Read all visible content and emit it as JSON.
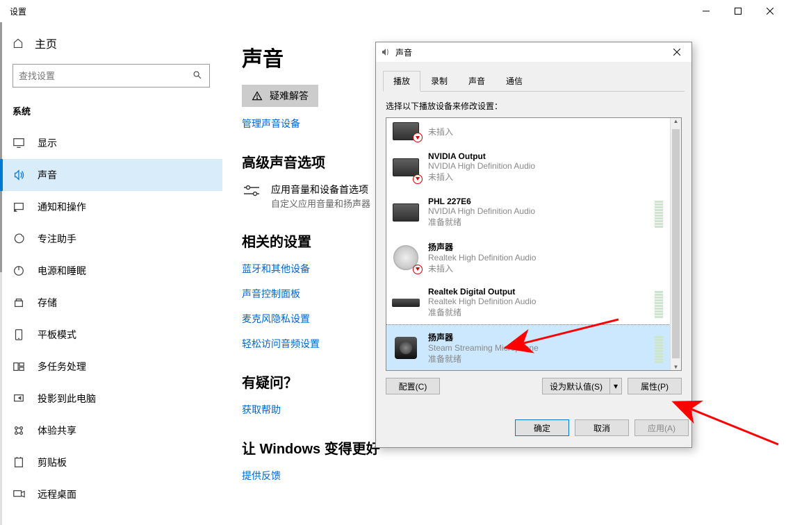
{
  "titlebar": {
    "title": "设置"
  },
  "sidebar": {
    "home": "主页",
    "search_placeholder": "查找设置",
    "section": "系统",
    "items": [
      {
        "label": "显示"
      },
      {
        "label": "声音"
      },
      {
        "label": "通知和操作"
      },
      {
        "label": "专注助手"
      },
      {
        "label": "电源和睡眠"
      },
      {
        "label": "存储"
      },
      {
        "label": "平板模式"
      },
      {
        "label": "多任务处理"
      },
      {
        "label": "投影到此电脑"
      },
      {
        "label": "体验共享"
      },
      {
        "label": "剪贴板"
      },
      {
        "label": "远程桌面"
      }
    ],
    "active_index": 1
  },
  "main": {
    "h1": "声音",
    "troubleshoot": "疑难解答",
    "manage_devices": "管理声音设备",
    "h2_advanced": "高级声音选项",
    "app_vol_title": "应用音量和设备首选项",
    "app_vol_sub": "自定义应用音量和扬声器",
    "h2_related": "相关的设置",
    "related_links": [
      "蓝牙和其他设备",
      "声音控制面板",
      "麦克风隐私设置",
      "轻松访问音频设置"
    ],
    "h2_question": "有疑问？",
    "get_help": "获取帮助",
    "h2_better": "让 Windows 变得更好",
    "feedback": "提供反馈"
  },
  "dialog": {
    "title": "声音",
    "tabs": [
      "播放",
      "录制",
      "声音",
      "通信"
    ],
    "active_tab": 0,
    "desc": "选择以下播放设备来修改设置：",
    "devices": [
      {
        "name": "",
        "sub": "",
        "status": "未插入",
        "kind": "monitor",
        "badge": true,
        "first": true
      },
      {
        "name": "NVIDIA Output",
        "sub": "NVIDIA High Definition Audio",
        "status": "未插入",
        "kind": "monitor",
        "badge": true
      },
      {
        "name": "PHL 227E6",
        "sub": "NVIDIA High Definition Audio",
        "status": "准备就绪",
        "kind": "monitor",
        "badge": false,
        "level": true
      },
      {
        "name": "扬声器",
        "sub": "Realtek High Definition Audio",
        "status": "未插入",
        "kind": "speaker_round",
        "badge": true
      },
      {
        "name": "Realtek Digital Output",
        "sub": "Realtek High Definition Audio",
        "status": "准备就绪",
        "kind": "black_box",
        "badge": false,
        "level": true
      },
      {
        "name": "扬声器",
        "sub": "Steam Streaming Microphone",
        "status": "准备就绪",
        "kind": "black_speaker",
        "badge": false,
        "level": true,
        "selected": true
      }
    ],
    "btn_configure": "配置(C)",
    "btn_default": "设为默认值(S)",
    "btn_props": "属性(P)",
    "btn_ok": "确定",
    "btn_cancel": "取消",
    "btn_apply": "应用(A)"
  }
}
